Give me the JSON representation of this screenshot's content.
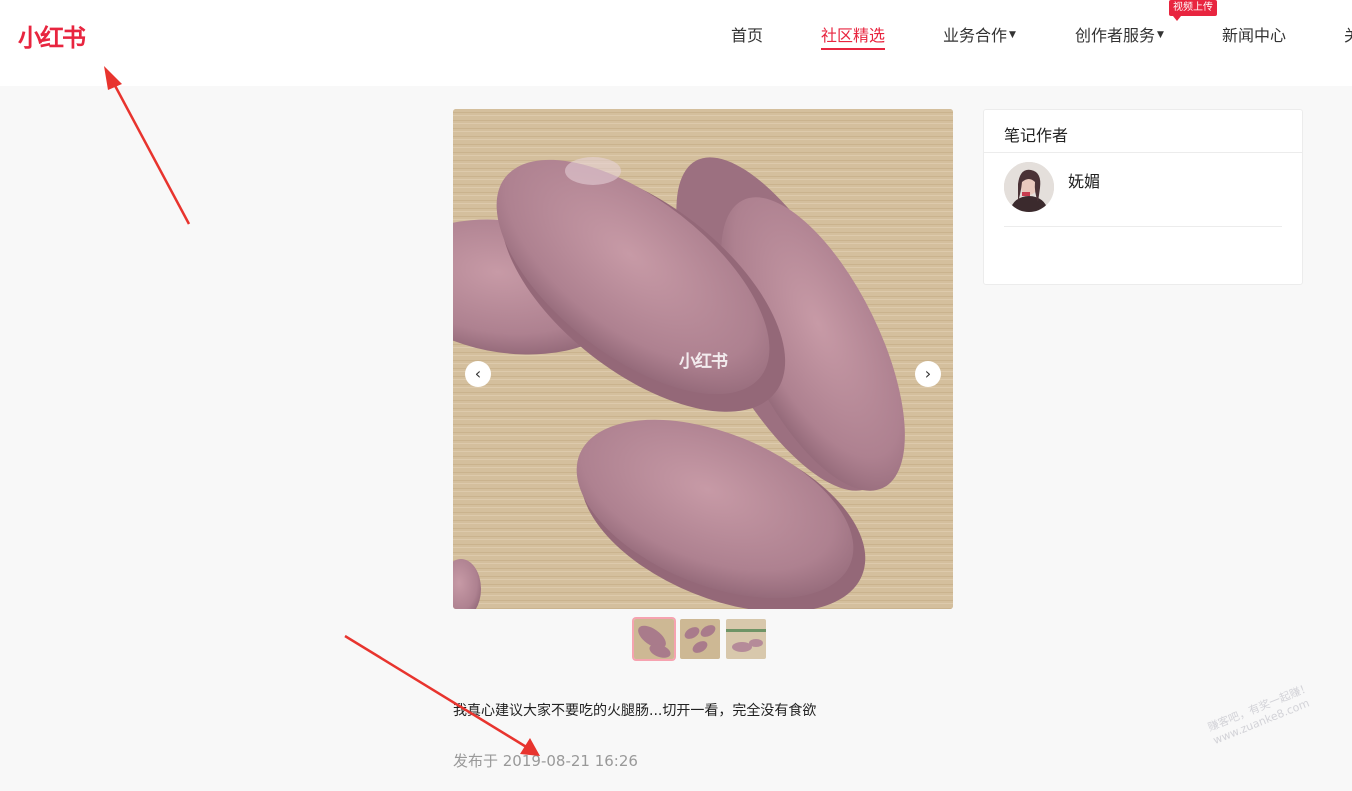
{
  "header": {
    "logo": "小红书",
    "nav": [
      {
        "label": "首页",
        "active": false,
        "dropdown": false
      },
      {
        "label": "社区精选",
        "active": true,
        "dropdown": false
      },
      {
        "label": "业务合作",
        "active": false,
        "dropdown": true
      },
      {
        "label": "创作者服务",
        "active": false,
        "dropdown": true
      },
      {
        "label": "新闻中心",
        "active": false,
        "dropdown": false
      },
      {
        "label": "关",
        "active": false,
        "dropdown": false
      }
    ],
    "badge": "视频上传",
    "caret": "▼"
  },
  "note": {
    "image_watermark": "小红书",
    "prev_icon": "‹",
    "next_icon": "›",
    "thumbnail_count": 3,
    "selected_thumbnail": 1,
    "description": "我真心建议大家不要吃的火腿肠...切开一看，完全没有食欲",
    "published": "发布于 2019-08-21 16:26"
  },
  "author": {
    "title": "笔记作者",
    "name": "妩媚"
  },
  "overlay": {
    "site_stamp_line1": "赚客吧，有奖一起赚！",
    "site_stamp_line2": "www.zuanke8.com"
  },
  "colors": {
    "brand": "#e8253f",
    "annotation_arrow": "#e8342e"
  }
}
